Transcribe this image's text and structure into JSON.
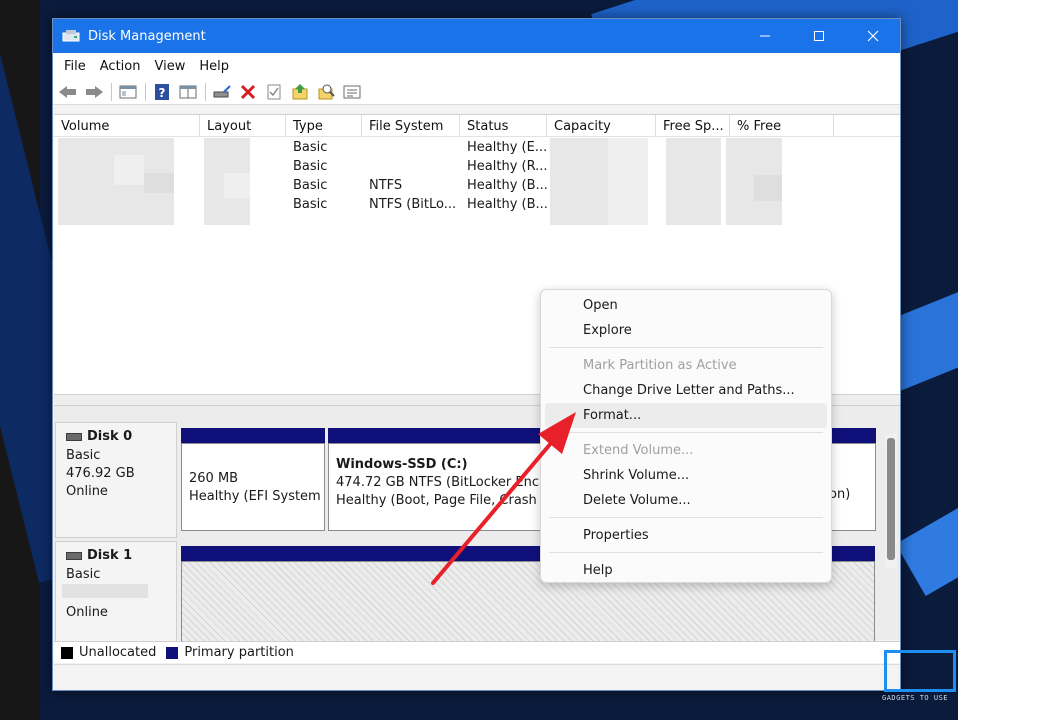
{
  "window": {
    "title": "Disk Management"
  },
  "menu": [
    "File",
    "Action",
    "View",
    "Help"
  ],
  "list": {
    "columns": [
      "Volume",
      "Layout",
      "Type",
      "File System",
      "Status",
      "Capacity",
      "Free Sp...",
      "% Free"
    ],
    "rows": [
      {
        "type": "Basic",
        "fs": "",
        "status": "Healthy (E..."
      },
      {
        "type": "Basic",
        "fs": "",
        "status": "Healthy (R..."
      },
      {
        "type": "Basic",
        "fs": "NTFS",
        "status": "Healthy (B..."
      },
      {
        "type": "Basic",
        "fs": "NTFS (BitLo...",
        "status": "Healthy (B..."
      }
    ]
  },
  "disks": {
    "disk0": {
      "name": "Disk 0",
      "kind": "Basic",
      "size": "476.92 GB",
      "state": "Online",
      "efi": {
        "size": "260 MB",
        "status": "Healthy (EFI System P"
      },
      "c": {
        "name": "Windows-SSD  (C:)",
        "info": "474.72 GB NTFS (BitLocker Encryp",
        "status": "Healthy (Boot, Page File, Crash Du"
      },
      "tail": "on)"
    },
    "disk1": {
      "name": "Disk 1",
      "kind": "Basic",
      "state": "Online"
    }
  },
  "legend": {
    "unallocated": "Unallocated",
    "primary": "Primary partition"
  },
  "context_menu": {
    "open": "Open",
    "explore": "Explore",
    "mark_active": "Mark Partition as Active",
    "change_letter": "Change Drive Letter and Paths...",
    "format": "Format...",
    "extend": "Extend Volume...",
    "shrink": "Shrink Volume...",
    "delete": "Delete Volume...",
    "properties": "Properties",
    "help": "Help"
  },
  "watermark": {
    "text": "GADGETS TO USE"
  },
  "colors": {
    "titlebar": "#1a73e8",
    "partition_bar": "#10107a",
    "arrow": "#e8202a"
  }
}
